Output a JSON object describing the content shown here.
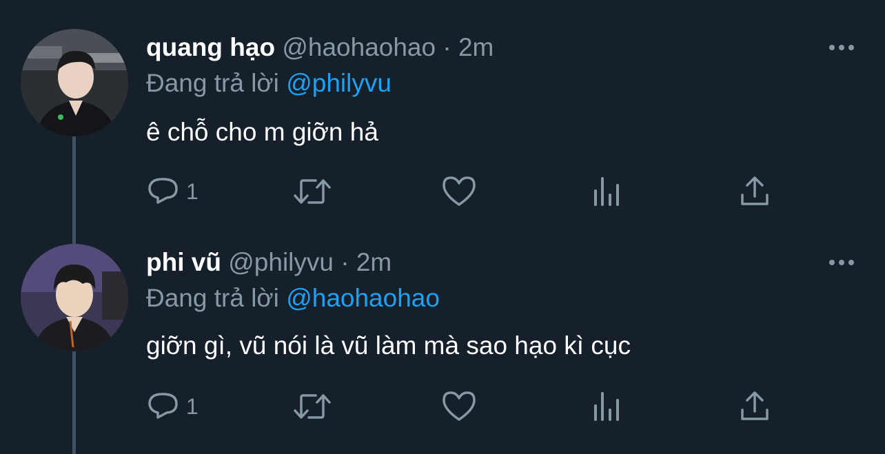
{
  "tweets": [
    {
      "name": "quang hạo",
      "handle": "@haohaohao",
      "separator": "·",
      "time": "2m",
      "replying_prefix": "Đang trả lời",
      "replying_to": "@philyvu",
      "text": "ê chỗ cho m giỡn hả",
      "reply_count": "1",
      "icons": [
        "more-icon",
        "reply-icon",
        "retweet-icon",
        "like-icon",
        "analytics-icon",
        "share-icon"
      ]
    },
    {
      "name": "phi vũ",
      "handle": "@philyvu",
      "separator": "·",
      "time": "2m",
      "replying_prefix": "Đang trả lời",
      "replying_to": "@haohaohao",
      "text": "giỡn gì, vũ nói là vũ làm mà sao hạo kì cục",
      "reply_count": "1",
      "icons": [
        "more-icon",
        "reply-icon",
        "retweet-icon",
        "like-icon",
        "analytics-icon",
        "share-icon"
      ]
    }
  ],
  "colors": {
    "background": "#15202b",
    "text_primary": "#ffffff",
    "text_secondary": "#8899a6",
    "accent": "#1da1f2",
    "thread_line": "#3d5466"
  }
}
